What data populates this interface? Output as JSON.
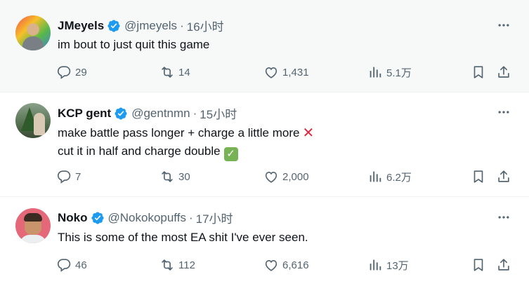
{
  "tweets": [
    {
      "name": "JMeyels",
      "handle": "@jmeyels",
      "separator": "·",
      "time": "16小时",
      "text_lines": [
        "im bout to just quit this game"
      ],
      "replies": "29",
      "retweets": "14",
      "likes": "1,431",
      "views": "5.1万"
    },
    {
      "name": "KCP gent",
      "handle": "@gentnmn",
      "separator": "·",
      "time": "15小时",
      "text_lines": [
        "make battle pass longer + charge a little more",
        "cut it in half and charge double"
      ],
      "replies": "7",
      "retweets": "30",
      "likes": "2,000",
      "views": "6.2万"
    },
    {
      "name": "Noko",
      "handle": "@Nokokopuffs",
      "separator": "·",
      "time": "17小时",
      "text_lines": [
        "This is some of the most EA shit I've ever seen."
      ],
      "replies": "46",
      "retweets": "112",
      "likes": "6,616",
      "views": "13万"
    }
  ],
  "icons": {
    "verified": "verified-badge-icon",
    "more": "more-dots-icon",
    "reply": "reply-bubble-icon",
    "retweet": "retweet-icon",
    "like": "heart-icon",
    "views": "views-bar-icon",
    "bookmark": "bookmark-icon",
    "share": "share-upload-icon",
    "cross_emoji": "cross-mark-emoji",
    "check_emoji": "check-mark-emoji"
  },
  "colors": {
    "verified": "#1d9bf0",
    "secondary_text": "#536471",
    "hover_row_bg": "#f7f9f9"
  }
}
